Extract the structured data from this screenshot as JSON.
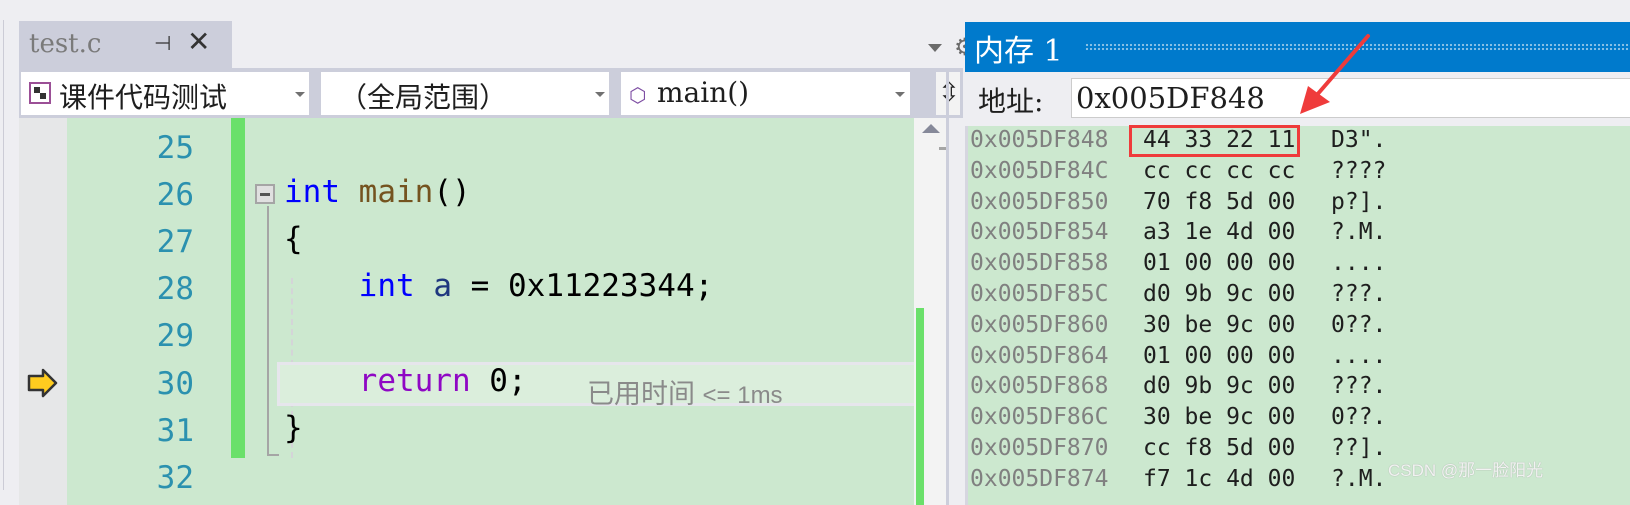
{
  "editor_tab": {
    "title": "test.c",
    "pin_icon": "pin-icon",
    "close_icon": "close-icon"
  },
  "toolbar": {
    "tab_list_icon": "dropdown-icon",
    "settings_icon": "gear-icon"
  },
  "navigation_bar": {
    "project": "课件代码测试",
    "scope": "（全局范围）",
    "member": "main()",
    "split_icon": "split-view-icon"
  },
  "code_editor": {
    "lines": [
      {
        "number": "25",
        "text": ""
      },
      {
        "number": "26",
        "text": "int main()"
      },
      {
        "number": "27",
        "text": "{"
      },
      {
        "number": "28",
        "text": "    int a = 0x11223344;"
      },
      {
        "number": "29",
        "text": ""
      },
      {
        "number": "30",
        "text": "    return 0;"
      },
      {
        "number": "31",
        "text": "}"
      },
      {
        "number": "32",
        "text": ""
      }
    ],
    "current_line": "30",
    "elapsed_label": "已用时间",
    "elapsed_value": "<= 1ms",
    "accent_change_bar": "#6ae06a"
  },
  "memory_window": {
    "title": "内存 1",
    "address_label": "地址:",
    "address_value": "0x005DF848",
    "rows": [
      {
        "address": "0x005DF848",
        "bytes": "44 33 22 11",
        "ascii": "D3\"."
      },
      {
        "address": "0x005DF84C",
        "bytes": "cc cc cc cc",
        "ascii": "????"
      },
      {
        "address": "0x005DF850",
        "bytes": "70 f8 5d 00",
        "ascii": "p?]."
      },
      {
        "address": "0x005DF854",
        "bytes": "a3 1e 4d 00",
        "ascii": "?.M."
      },
      {
        "address": "0x005DF858",
        "bytes": "01 00 00 00",
        "ascii": "...."
      },
      {
        "address": "0x005DF85C",
        "bytes": "d0 9b 9c 00",
        "ascii": "???."
      },
      {
        "address": "0x005DF860",
        "bytes": "30 be 9c 00",
        "ascii": "0??."
      },
      {
        "address": "0x005DF864",
        "bytes": "01 00 00 00",
        "ascii": "...."
      },
      {
        "address": "0x005DF868",
        "bytes": "d0 9b 9c 00",
        "ascii": "???."
      },
      {
        "address": "0x005DF86C",
        "bytes": "30 be 9c 00",
        "ascii": "0??."
      },
      {
        "address": "0x005DF870",
        "bytes": "cc f8 5d 00",
        "ascii": "??]."
      },
      {
        "address": "0x005DF874",
        "bytes": "f7 1c 4d 00",
        "ascii": "?.M."
      }
    ],
    "title_color": "#007acc",
    "highlight_color": "#ef3b3b"
  },
  "watermark": "CSDN @那一脸阳光"
}
